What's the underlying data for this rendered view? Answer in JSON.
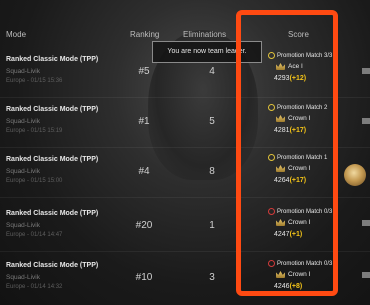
{
  "header": {
    "mode": "Mode",
    "ranking": "Ranking",
    "eliminations": "Eliminations",
    "score": "Score"
  },
  "toast": "You are now team leader.",
  "rows": [
    {
      "mode": "Ranked Classic Mode (TPP)",
      "squad": "Squad-Livik",
      "region": "Europe - 01/15 15:36",
      "rank": "#5",
      "eliminations": "4",
      "match_title": "Promotion Match 3/3",
      "match_icon": "check-circle",
      "tier": "Ace",
      "tier_level": "I",
      "points": "4293",
      "delta": "(+12)"
    },
    {
      "mode": "Ranked Classic Mode (TPP)",
      "squad": "Squad-Livik",
      "region": "Europe - 01/15 15:19",
      "rank": "#1",
      "eliminations": "5",
      "match_title": "Promotion Match 2",
      "match_icon": "check-circle",
      "tier": "Crown",
      "tier_level": "I",
      "points": "4281",
      "delta": "(+17)"
    },
    {
      "mode": "Ranked Classic Mode (TPP)",
      "squad": "Squad-Livik",
      "region": "Europe - 01/15 15:00",
      "rank": "#4",
      "eliminations": "8",
      "match_title": "Promotion Match 1",
      "match_icon": "check-circle",
      "tier": "Crown",
      "tier_level": "I",
      "points": "4264",
      "delta": "(+17)"
    },
    {
      "mode": "Ranked Classic Mode (TPP)",
      "squad": "Squad-Livik",
      "region": "Europe - 01/14 14:47",
      "rank": "#20",
      "eliminations": "1",
      "match_title": "Promotion Match 0/3",
      "match_icon": "x-circle",
      "tier": "Crown",
      "tier_level": "I",
      "points": "4247",
      "delta": "(+1)"
    },
    {
      "mode": "Ranked Classic Mode (TPP)",
      "squad": "Squad-Livik",
      "region": "Europe - 01/14 14:32",
      "rank": "#10",
      "eliminations": "3",
      "match_title": "Promotion Match 0/3",
      "match_icon": "x-circle",
      "tier": "Crown",
      "tier_level": "I",
      "points": "4246",
      "delta": "(+8)"
    }
  ],
  "colors": {
    "annotation": "#ff4a12",
    "delta": "#f5c518",
    "success_icon": "#e0c23a",
    "fail_icon": "#d23b3b"
  }
}
